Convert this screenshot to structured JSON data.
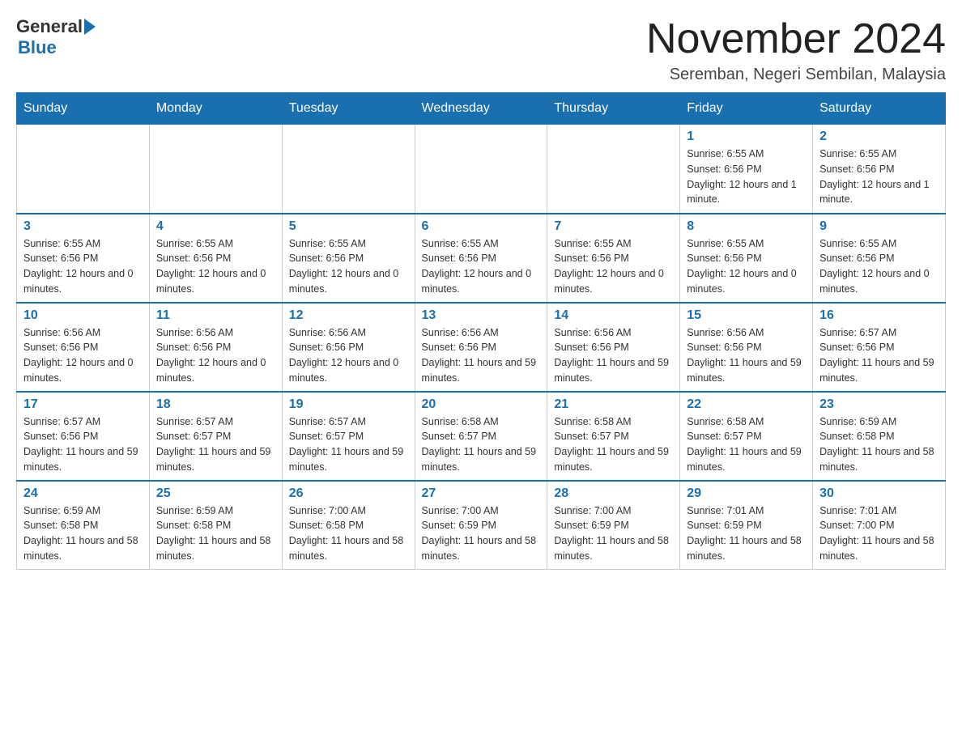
{
  "header": {
    "logo_general": "General",
    "logo_blue": "Blue",
    "month_title": "November 2024",
    "location": "Seremban, Negeri Sembilan, Malaysia"
  },
  "days_of_week": [
    "Sunday",
    "Monday",
    "Tuesday",
    "Wednesday",
    "Thursday",
    "Friday",
    "Saturday"
  ],
  "weeks": [
    [
      {
        "day": "",
        "info": ""
      },
      {
        "day": "",
        "info": ""
      },
      {
        "day": "",
        "info": ""
      },
      {
        "day": "",
        "info": ""
      },
      {
        "day": "",
        "info": ""
      },
      {
        "day": "1",
        "info": "Sunrise: 6:55 AM\nSunset: 6:56 PM\nDaylight: 12 hours and 1 minute."
      },
      {
        "day": "2",
        "info": "Sunrise: 6:55 AM\nSunset: 6:56 PM\nDaylight: 12 hours and 1 minute."
      }
    ],
    [
      {
        "day": "3",
        "info": "Sunrise: 6:55 AM\nSunset: 6:56 PM\nDaylight: 12 hours and 0 minutes."
      },
      {
        "day": "4",
        "info": "Sunrise: 6:55 AM\nSunset: 6:56 PM\nDaylight: 12 hours and 0 minutes."
      },
      {
        "day": "5",
        "info": "Sunrise: 6:55 AM\nSunset: 6:56 PM\nDaylight: 12 hours and 0 minutes."
      },
      {
        "day": "6",
        "info": "Sunrise: 6:55 AM\nSunset: 6:56 PM\nDaylight: 12 hours and 0 minutes."
      },
      {
        "day": "7",
        "info": "Sunrise: 6:55 AM\nSunset: 6:56 PM\nDaylight: 12 hours and 0 minutes."
      },
      {
        "day": "8",
        "info": "Sunrise: 6:55 AM\nSunset: 6:56 PM\nDaylight: 12 hours and 0 minutes."
      },
      {
        "day": "9",
        "info": "Sunrise: 6:55 AM\nSunset: 6:56 PM\nDaylight: 12 hours and 0 minutes."
      }
    ],
    [
      {
        "day": "10",
        "info": "Sunrise: 6:56 AM\nSunset: 6:56 PM\nDaylight: 12 hours and 0 minutes."
      },
      {
        "day": "11",
        "info": "Sunrise: 6:56 AM\nSunset: 6:56 PM\nDaylight: 12 hours and 0 minutes."
      },
      {
        "day": "12",
        "info": "Sunrise: 6:56 AM\nSunset: 6:56 PM\nDaylight: 12 hours and 0 minutes."
      },
      {
        "day": "13",
        "info": "Sunrise: 6:56 AM\nSunset: 6:56 PM\nDaylight: 11 hours and 59 minutes."
      },
      {
        "day": "14",
        "info": "Sunrise: 6:56 AM\nSunset: 6:56 PM\nDaylight: 11 hours and 59 minutes."
      },
      {
        "day": "15",
        "info": "Sunrise: 6:56 AM\nSunset: 6:56 PM\nDaylight: 11 hours and 59 minutes."
      },
      {
        "day": "16",
        "info": "Sunrise: 6:57 AM\nSunset: 6:56 PM\nDaylight: 11 hours and 59 minutes."
      }
    ],
    [
      {
        "day": "17",
        "info": "Sunrise: 6:57 AM\nSunset: 6:56 PM\nDaylight: 11 hours and 59 minutes."
      },
      {
        "day": "18",
        "info": "Sunrise: 6:57 AM\nSunset: 6:57 PM\nDaylight: 11 hours and 59 minutes."
      },
      {
        "day": "19",
        "info": "Sunrise: 6:57 AM\nSunset: 6:57 PM\nDaylight: 11 hours and 59 minutes."
      },
      {
        "day": "20",
        "info": "Sunrise: 6:58 AM\nSunset: 6:57 PM\nDaylight: 11 hours and 59 minutes."
      },
      {
        "day": "21",
        "info": "Sunrise: 6:58 AM\nSunset: 6:57 PM\nDaylight: 11 hours and 59 minutes."
      },
      {
        "day": "22",
        "info": "Sunrise: 6:58 AM\nSunset: 6:57 PM\nDaylight: 11 hours and 59 minutes."
      },
      {
        "day": "23",
        "info": "Sunrise: 6:59 AM\nSunset: 6:58 PM\nDaylight: 11 hours and 58 minutes."
      }
    ],
    [
      {
        "day": "24",
        "info": "Sunrise: 6:59 AM\nSunset: 6:58 PM\nDaylight: 11 hours and 58 minutes."
      },
      {
        "day": "25",
        "info": "Sunrise: 6:59 AM\nSunset: 6:58 PM\nDaylight: 11 hours and 58 minutes."
      },
      {
        "day": "26",
        "info": "Sunrise: 7:00 AM\nSunset: 6:58 PM\nDaylight: 11 hours and 58 minutes."
      },
      {
        "day": "27",
        "info": "Sunrise: 7:00 AM\nSunset: 6:59 PM\nDaylight: 11 hours and 58 minutes."
      },
      {
        "day": "28",
        "info": "Sunrise: 7:00 AM\nSunset: 6:59 PM\nDaylight: 11 hours and 58 minutes."
      },
      {
        "day": "29",
        "info": "Sunrise: 7:01 AM\nSunset: 6:59 PM\nDaylight: 11 hours and 58 minutes."
      },
      {
        "day": "30",
        "info": "Sunrise: 7:01 AM\nSunset: 7:00 PM\nDaylight: 11 hours and 58 minutes."
      }
    ]
  ]
}
